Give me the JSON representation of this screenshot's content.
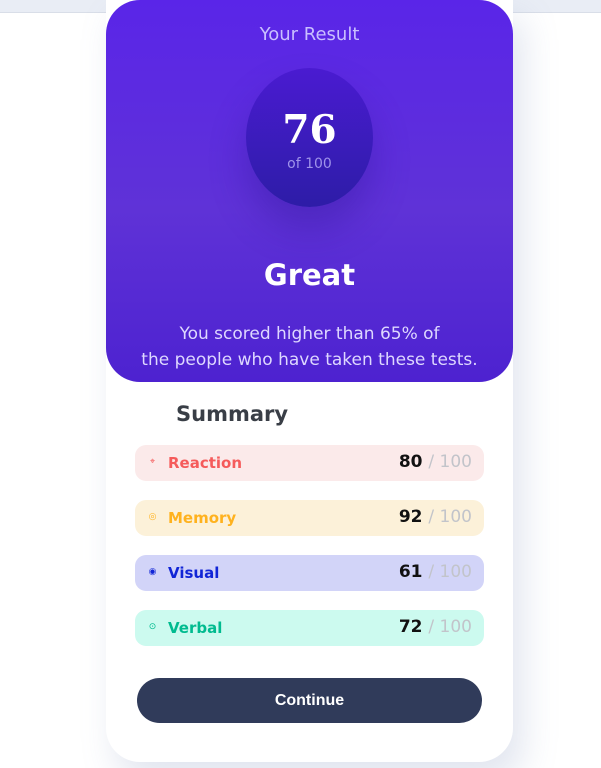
{
  "result": {
    "title": "Your Result",
    "score": "76",
    "score_max": "of 100",
    "rating": "Great",
    "message_line1": "You scored higher than 65% of",
    "message_line2": "the people who have taken these tests."
  },
  "summary": {
    "title": "Summary",
    "items": [
      {
        "label": "Reaction",
        "score": "80",
        "max": "/ 100",
        "icon": "lightning-icon",
        "color": "#f55b5b",
        "background": "#fbeaea"
      },
      {
        "label": "Memory",
        "score": "92",
        "max": "/ 100",
        "icon": "brain-icon",
        "color": "#ffb21e",
        "background": "#fcf1d9"
      },
      {
        "label": "Visual",
        "score": "61",
        "max": "/ 100",
        "icon": "eye-icon",
        "color": "#1125d6",
        "background": "#d2d4f8"
      },
      {
        "label": "Verbal",
        "score": "72",
        "max": "/ 100",
        "icon": "chat-icon",
        "color": "#00bb8f",
        "background": "#ccfaef"
      }
    ]
  },
  "actions": {
    "continue_label": "Continue"
  },
  "colors": {
    "panel_gradient_start": "#5a25e8",
    "panel_gradient_end": "#4d22d0",
    "button": "#303b5a"
  }
}
